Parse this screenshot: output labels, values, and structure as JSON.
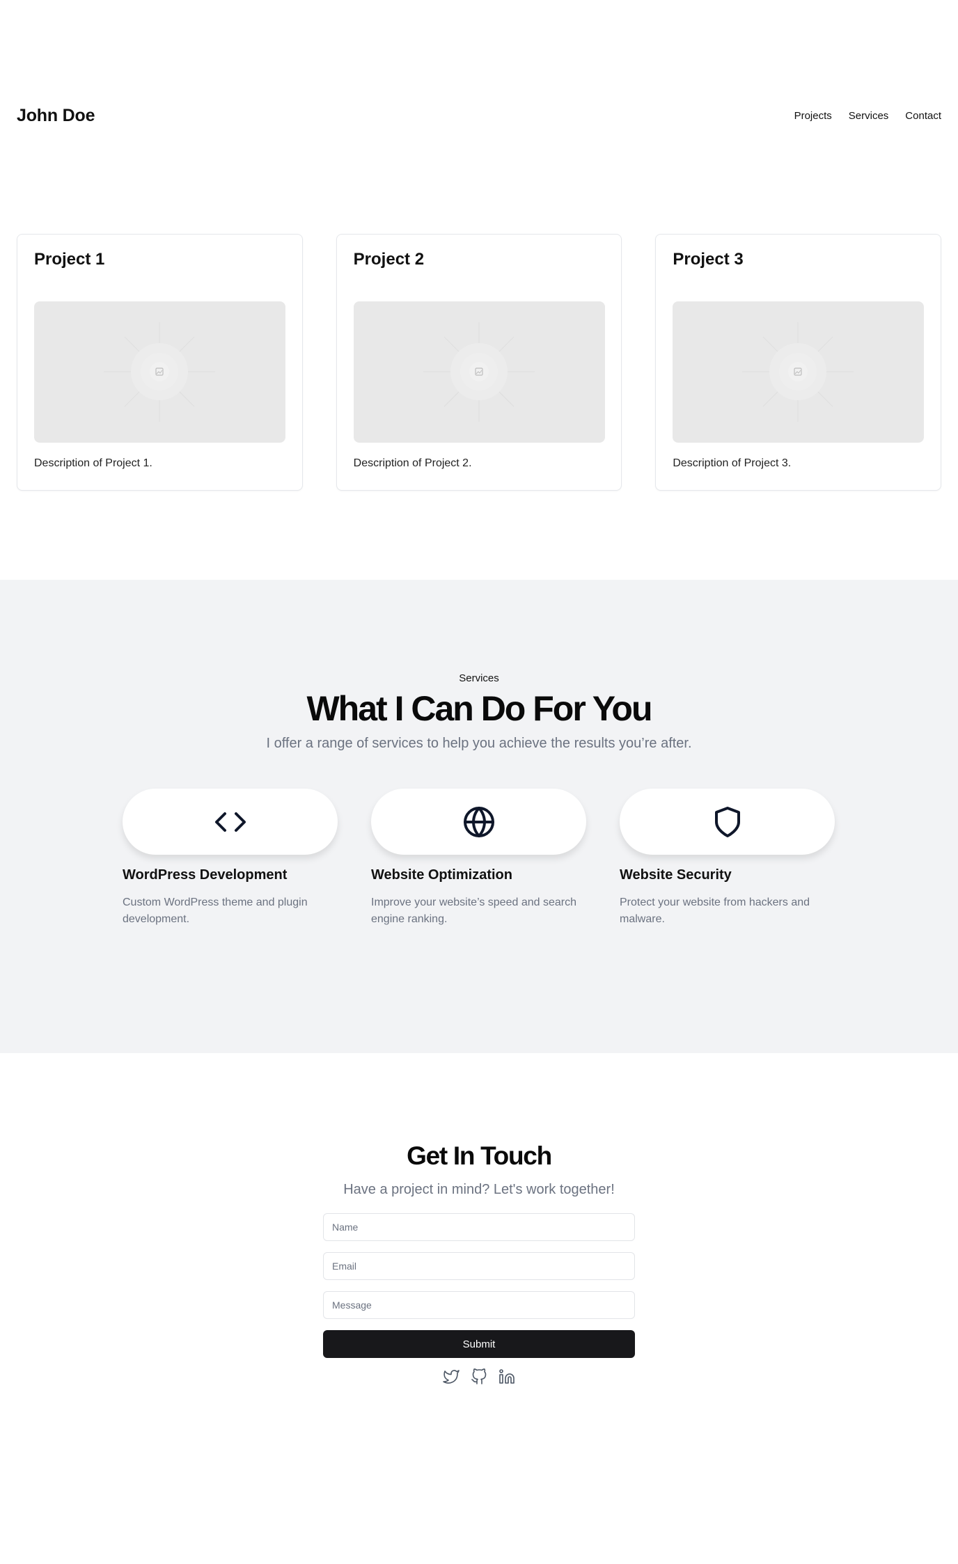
{
  "header": {
    "brand": "John Doe",
    "nav": [
      "Projects",
      "Services",
      "Contact"
    ]
  },
  "projects": [
    {
      "title": "Project 1",
      "description": "Description of Project 1."
    },
    {
      "title": "Project 2",
      "description": "Description of Project 2."
    },
    {
      "title": "Project 3",
      "description": "Description of Project 3."
    }
  ],
  "services": {
    "eyebrow": "Services",
    "title": "What I Can Do For You",
    "subtitle": "I offer a range of services to help you achieve the results you’re after.",
    "items": [
      {
        "icon": "code-icon",
        "name": "WordPress Development",
        "description": "Custom WordPress theme and plugin development."
      },
      {
        "icon": "globe-icon",
        "name": "Website Optimization",
        "description": "Improve your website’s speed and search engine ranking."
      },
      {
        "icon": "shield-icon",
        "name": "Website Security",
        "description": "Protect your website from hackers and malware."
      }
    ]
  },
  "contact": {
    "title": "Get In Touch",
    "subtitle": "Have a project in mind? Let's work together!",
    "name_placeholder": "Name",
    "email_placeholder": "Email",
    "message_placeholder": "Message",
    "submit_label": "Submit",
    "socials": [
      "twitter-icon",
      "github-icon",
      "linkedin-icon"
    ]
  },
  "colors": {
    "services_bg": "#f2f3f5",
    "submit_bg": "#18181b",
    "muted_text": "#6b7280"
  }
}
